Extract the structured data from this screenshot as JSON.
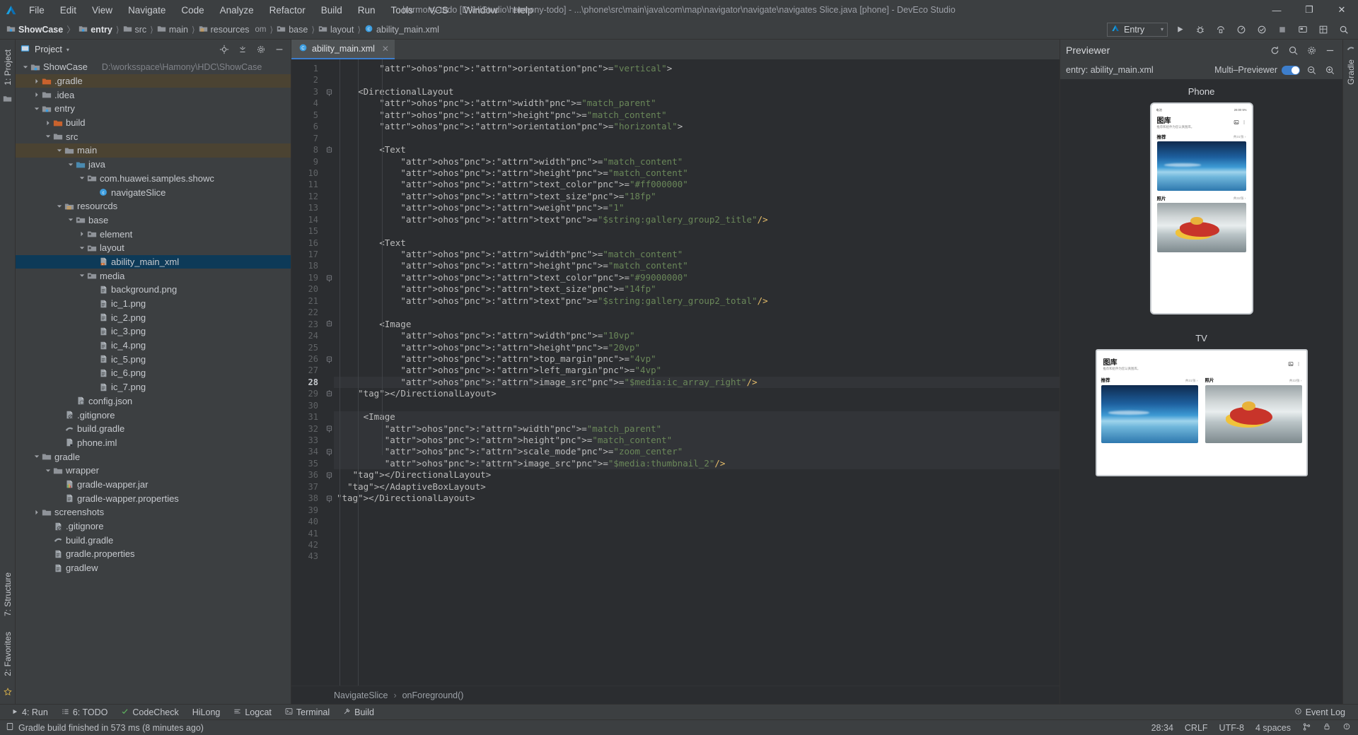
{
  "window": {
    "title": "harmony-todo [D:\\HiStudio\\harmony-todo] - ...\\phone\\src\\main\\java\\com\\map\\navigator\\navigate\\navigates Slice.java [phone] - DevEco Studio",
    "minimize": "—",
    "maximize": "❐",
    "close": "✕"
  },
  "menu": {
    "items": [
      "File",
      "Edit",
      "View",
      "Navigate",
      "Code",
      "Analyze",
      "Refactor",
      "Build",
      "Run",
      "Tools",
      "VCS",
      "Window",
      "Help"
    ]
  },
  "breadcrumb": {
    "items": [
      {
        "label": "ShowCase",
        "icon": "module-icon",
        "bold": true
      },
      {
        "label": "entry",
        "icon": "module-icon",
        "bold": true
      },
      {
        "label": "src",
        "icon": "folder-icon",
        "bold": false
      },
      {
        "label": "main",
        "icon": "folder-icon",
        "bold": false
      },
      {
        "label": "resources",
        "icon": "resource-folder-icon",
        "bold": false
      },
      {
        "label": "om",
        "icon": "none",
        "bold": false
      },
      {
        "label": "base",
        "icon": "res-folder-icon",
        "bold": false
      },
      {
        "label": "layout",
        "icon": "res-folder-icon",
        "bold": false
      },
      {
        "label": "ability_main.xml",
        "icon": "xml-file-icon",
        "bold": false
      }
    ],
    "separator": "〉"
  },
  "run_config": {
    "label": "Entry",
    "icon": "deveco-logo-icon",
    "caret": "▾",
    "actions": [
      "run-button",
      "debug-button",
      "attach-debugger-button",
      "profiler-button",
      "coverage-button",
      "stop-button",
      "device-manager-button",
      "layout-inspector-button",
      "search-everywhere-button"
    ]
  },
  "left_strip": {
    "tabs": [
      "1: Project"
    ],
    "bottom_tabs": [
      "7: Structure",
      "2: Favorites"
    ],
    "favorite_icon": "star-icon"
  },
  "right_strip": {
    "tabs": [
      "Gradle"
    ]
  },
  "project_panel": {
    "title": "Project",
    "caret": "▾",
    "icons": [
      "locate-icon",
      "collapse-all-icon",
      "settings-gear-icon",
      "hide-icon"
    ],
    "tree": [
      {
        "depth": 0,
        "label": "ShowCase",
        "path": "D:\\worksspace\\Hamony\\HDC\\ShowCase",
        "arrow": "down",
        "icon": "module-icon",
        "state": "normal"
      },
      {
        "depth": 1,
        "label": ".gradle",
        "arrow": "right",
        "icon": "orange-folder-icon",
        "state": "hl"
      },
      {
        "depth": 1,
        "label": ".idea",
        "arrow": "right",
        "icon": "folder-icon",
        "state": "normal"
      },
      {
        "depth": 1,
        "label": "entry",
        "arrow": "down",
        "icon": "module-icon",
        "state": "normal"
      },
      {
        "depth": 2,
        "label": "build",
        "arrow": "right",
        "icon": "orange-folder-icon",
        "state": "normal"
      },
      {
        "depth": 2,
        "label": "src",
        "arrow": "down",
        "icon": "folder-icon",
        "state": "normal"
      },
      {
        "depth": 3,
        "label": "main",
        "arrow": "down",
        "icon": "folder-icon",
        "state": "hl"
      },
      {
        "depth": 4,
        "label": "java",
        "arrow": "down",
        "icon": "source-folder-icon",
        "state": "normal"
      },
      {
        "depth": 5,
        "label": "com.huawei.samples.showc",
        "arrow": "down",
        "icon": "package-icon",
        "state": "normal"
      },
      {
        "depth": 6,
        "label": "navigateSlice",
        "arrow": "none",
        "icon": "class-icon",
        "state": "normal"
      },
      {
        "depth": 3,
        "label": "resourcds",
        "arrow": "down",
        "icon": "resource-folder-icon",
        "state": "normal"
      },
      {
        "depth": 4,
        "label": "base",
        "arrow": "down",
        "icon": "res-folder-icon",
        "state": "normal"
      },
      {
        "depth": 5,
        "label": "element",
        "arrow": "right",
        "icon": "res-folder-icon",
        "state": "normal"
      },
      {
        "depth": 5,
        "label": "layout",
        "arrow": "down",
        "icon": "res-folder-icon",
        "state": "normal"
      },
      {
        "depth": 6,
        "label": "ability_main_xml",
        "arrow": "none",
        "icon": "xml-file-icon",
        "state": "sel"
      },
      {
        "depth": 5,
        "label": "media",
        "arrow": "down",
        "icon": "res-folder-icon",
        "state": "normal"
      },
      {
        "depth": 6,
        "label": "background.png",
        "arrow": "none",
        "icon": "file-icon",
        "state": "normal"
      },
      {
        "depth": 6,
        "label": "ic_1.png",
        "arrow": "none",
        "icon": "file-icon",
        "state": "normal"
      },
      {
        "depth": 6,
        "label": "ic_2.png",
        "arrow": "none",
        "icon": "file-icon",
        "state": "normal"
      },
      {
        "depth": 6,
        "label": "ic_3.png",
        "arrow": "none",
        "icon": "file-icon",
        "state": "normal"
      },
      {
        "depth": 6,
        "label": "ic_4.png",
        "arrow": "none",
        "icon": "file-icon",
        "state": "normal"
      },
      {
        "depth": 6,
        "label": "ic_5.png",
        "arrow": "none",
        "icon": "file-icon",
        "state": "normal"
      },
      {
        "depth": 6,
        "label": "ic_6.png",
        "arrow": "none",
        "icon": "file-icon",
        "state": "normal"
      },
      {
        "depth": 6,
        "label": "ic_7.png",
        "arrow": "none",
        "icon": "file-icon",
        "state": "normal"
      },
      {
        "depth": 4,
        "label": "config.json",
        "arrow": "none",
        "icon": "json-file-icon",
        "state": "normal"
      },
      {
        "depth": 3,
        "label": ".gitignore",
        "arrow": "none",
        "icon": "gitignore-file-icon",
        "state": "normal"
      },
      {
        "depth": 3,
        "label": "build.gradle",
        "arrow": "none",
        "icon": "gradle-file-icon",
        "state": "normal"
      },
      {
        "depth": 3,
        "label": "phone.iml",
        "arrow": "none",
        "icon": "iml-file-icon",
        "state": "normal"
      },
      {
        "depth": 1,
        "label": "gradle",
        "arrow": "down",
        "icon": "folder-icon",
        "state": "normal"
      },
      {
        "depth": 2,
        "label": "wrapper",
        "arrow": "down",
        "icon": "folder-icon",
        "state": "normal"
      },
      {
        "depth": 3,
        "label": "gradle-wapper.jar",
        "arrow": "none",
        "icon": "jar-file-icon",
        "state": "normal"
      },
      {
        "depth": 3,
        "label": "gradle-wapper.properties",
        "arrow": "none",
        "icon": "file-icon",
        "state": "normal"
      },
      {
        "depth": 1,
        "label": "screenshots",
        "arrow": "right",
        "icon": "folder-icon",
        "state": "normal"
      },
      {
        "depth": 2,
        "label": ".gitignore",
        "arrow": "none",
        "icon": "gitignore-file-icon",
        "state": "normal"
      },
      {
        "depth": 2,
        "label": "build.gradle",
        "arrow": "none",
        "icon": "gradle-file-icon",
        "state": "normal"
      },
      {
        "depth": 2,
        "label": "gradle.properties",
        "arrow": "none",
        "icon": "file-icon",
        "state": "normal"
      },
      {
        "depth": 2,
        "label": "gradlew",
        "arrow": "none",
        "icon": "file-icon",
        "state": "normal"
      }
    ]
  },
  "editor": {
    "tab": {
      "label": "ability_main.xml",
      "icon": "xml-file-icon",
      "close": "✕"
    },
    "cursor_line": 28,
    "lines": [
      {
        "n": 1,
        "fold": "",
        "block": false,
        "text": "        ohos:orientation=\"vertical\">"
      },
      {
        "n": 2,
        "fold": "",
        "block": false,
        "text": ""
      },
      {
        "n": 3,
        "fold": "minus",
        "block": false,
        "text": "    <DirectionalLayout"
      },
      {
        "n": 4,
        "fold": "",
        "block": false,
        "text": "        ohos:width=\"match_parent\""
      },
      {
        "n": 5,
        "fold": "",
        "block": false,
        "text": "        ohos:height=\"match_content\""
      },
      {
        "n": 6,
        "fold": "",
        "block": false,
        "text": "        ohos:orientation=\"horizontal\">"
      },
      {
        "n": 7,
        "fold": "",
        "block": false,
        "text": ""
      },
      {
        "n": 8,
        "fold": "plus",
        "block": false,
        "text": "        <Text"
      },
      {
        "n": 9,
        "fold": "",
        "block": false,
        "text": "            ohos:width=\"match_content\""
      },
      {
        "n": 10,
        "fold": "",
        "block": false,
        "text": "            ohos:height=\"match_content\""
      },
      {
        "n": 11,
        "fold": "",
        "block": false,
        "text": "            ohos:text_color=\"#ff000000\""
      },
      {
        "n": 12,
        "fold": "",
        "block": false,
        "text": "            ohos:text_size=\"18fp\""
      },
      {
        "n": 13,
        "fold": "",
        "block": false,
        "text": "            ohos:weight=\"1\""
      },
      {
        "n": 14,
        "fold": "",
        "block": false,
        "text": "            ohos:text=\"$string:gallery_group2_title\"/>"
      },
      {
        "n": 15,
        "fold": "",
        "block": false,
        "text": ""
      },
      {
        "n": 16,
        "fold": "",
        "block": false,
        "text": "        <Text"
      },
      {
        "n": 17,
        "fold": "",
        "block": false,
        "text": "            ohos:width=\"match_content\""
      },
      {
        "n": 18,
        "fold": "",
        "block": false,
        "text": "            ohos:height=\"match_content\""
      },
      {
        "n": 19,
        "fold": "minus",
        "block": false,
        "text": "            ohos:text_color=\"#99000000\""
      },
      {
        "n": 20,
        "fold": "",
        "block": false,
        "text": "            ohos:text_size=\"14fp\""
      },
      {
        "n": 21,
        "fold": "",
        "block": false,
        "text": "            ohos:text=\"$string:gallery_group2_total\"/>"
      },
      {
        "n": 22,
        "fold": "",
        "block": false,
        "text": ""
      },
      {
        "n": 23,
        "fold": "plus",
        "block": false,
        "text": "        <Image"
      },
      {
        "n": 24,
        "fold": "",
        "block": false,
        "text": "            ohos:width=\"10vp\""
      },
      {
        "n": 25,
        "fold": "",
        "block": false,
        "text": "            ohos:height=\"20vp\""
      },
      {
        "n": 26,
        "fold": "minus",
        "block": false,
        "text": "            ohos:top_margin=\"4vp\""
      },
      {
        "n": 27,
        "fold": "",
        "block": false,
        "text": "            ohos:left_margin=\"4vp\""
      },
      {
        "n": 28,
        "fold": "",
        "block": false,
        "text": "            ohos:image_src=\"$media:ic_array_right\"/>"
      },
      {
        "n": 29,
        "fold": "plus",
        "block": false,
        "text": "    </DirectionalLayout>"
      },
      {
        "n": 30,
        "fold": "",
        "block": false,
        "text": ""
      },
      {
        "n": 31,
        "fold": "",
        "block": true,
        "text": "     <Image"
      },
      {
        "n": 32,
        "fold": "minus",
        "block": true,
        "text": "         ohos:width=\"match_parent\""
      },
      {
        "n": 33,
        "fold": "",
        "block": true,
        "text": "         ohos:height=\"match_content\""
      },
      {
        "n": 34,
        "fold": "minus",
        "block": true,
        "text": "         ohos:scale_mode=\"zoom_center\""
      },
      {
        "n": 35,
        "fold": "",
        "block": true,
        "text": "         ohos:image_src=\"$media:thumbnail_2\"/>"
      },
      {
        "n": 36,
        "fold": "minus",
        "block": false,
        "text": "   </DirectionalLayout>"
      },
      {
        "n": 37,
        "fold": "",
        "block": false,
        "text": "  </AdaptiveBoxLayout>"
      },
      {
        "n": 38,
        "fold": "minus",
        "block": false,
        "text": "</DirectionalLayout>"
      },
      {
        "n": 39,
        "fold": "",
        "block": false,
        "text": ""
      },
      {
        "n": 40,
        "fold": "",
        "block": false,
        "text": ""
      },
      {
        "n": 41,
        "fold": "",
        "block": false,
        "text": ""
      },
      {
        "n": 42,
        "fold": "",
        "block": false,
        "text": ""
      },
      {
        "n": 43,
        "fold": "",
        "block": false,
        "text": ""
      }
    ],
    "bottom_breadcrumb": [
      "NavigateSlice",
      "onForeground()"
    ],
    "bottom_breadcrumb_sep": "›"
  },
  "previewer": {
    "title": "Previewer",
    "header_icons": [
      "refresh-icon",
      "search-icon",
      "settings-gear-icon",
      "hide-icon"
    ],
    "file_label": "entry: ability_main.xml",
    "multi_previewer_label": "Multi–Previewer",
    "zoom_out_icon": "zoom-out-icon",
    "zoom_in_icon": "zoom-in-icon",
    "devices": [
      {
        "name": "Phone",
        "status_left": "电池",
        "status_right": "26:00 5%",
        "app_title": "图库",
        "app_sub": "推荐和组件为您认真图库。",
        "sections": [
          {
            "title": "推荐",
            "count": "共31张 ›",
            "image": "sea"
          },
          {
            "title": "照片",
            "count": "共32张 ›",
            "image": "kayak"
          }
        ],
        "icons": [
          "image-icon",
          "more-icon"
        ]
      },
      {
        "name": "TV",
        "app_title": "图库",
        "app_sub": "推荐和组件为您认真图库。",
        "sections": [
          {
            "title": "推荐",
            "count": "共31张 ›",
            "image": "sea"
          },
          {
            "title": "照片",
            "count": "共33张 ›",
            "image": "kayak"
          }
        ],
        "icons": [
          "image-icon",
          "more-icon"
        ]
      }
    ]
  },
  "toolwindow_bar": {
    "buttons": [
      {
        "label": "4: Run",
        "icon": "run-icon"
      },
      {
        "label": "6: TODO",
        "icon": "todo-icon"
      },
      {
        "label": "CodeCheck",
        "icon": "codecheck-icon"
      },
      {
        "label": "HiLong",
        "icon": "none"
      },
      {
        "label": "Logcat",
        "icon": "logcat-icon"
      },
      {
        "label": "Terminal",
        "icon": "terminal-icon"
      },
      {
        "label": "Build",
        "icon": "build-icon"
      }
    ],
    "right": [
      {
        "label": "Event Log",
        "icon": "event-log-icon"
      }
    ]
  },
  "status_bar": {
    "message": "Gradle build finished in 573 ms (8 minutes ago)",
    "message_icon": "build-status-icon",
    "caret_position": "28:34",
    "line_separator": "CRLF",
    "encoding": "UTF-8",
    "indent": "4 spaces",
    "right_icons": [
      "branch-icon",
      "lock-icon",
      "inspection-icon"
    ]
  },
  "colors": {
    "accent": "#3d7ecc",
    "tag": "#e8bf6a",
    "attr": "#9876aa",
    "string": "#6a8759",
    "selection": "#0d3a58",
    "highlight_row": "#4b4332"
  }
}
